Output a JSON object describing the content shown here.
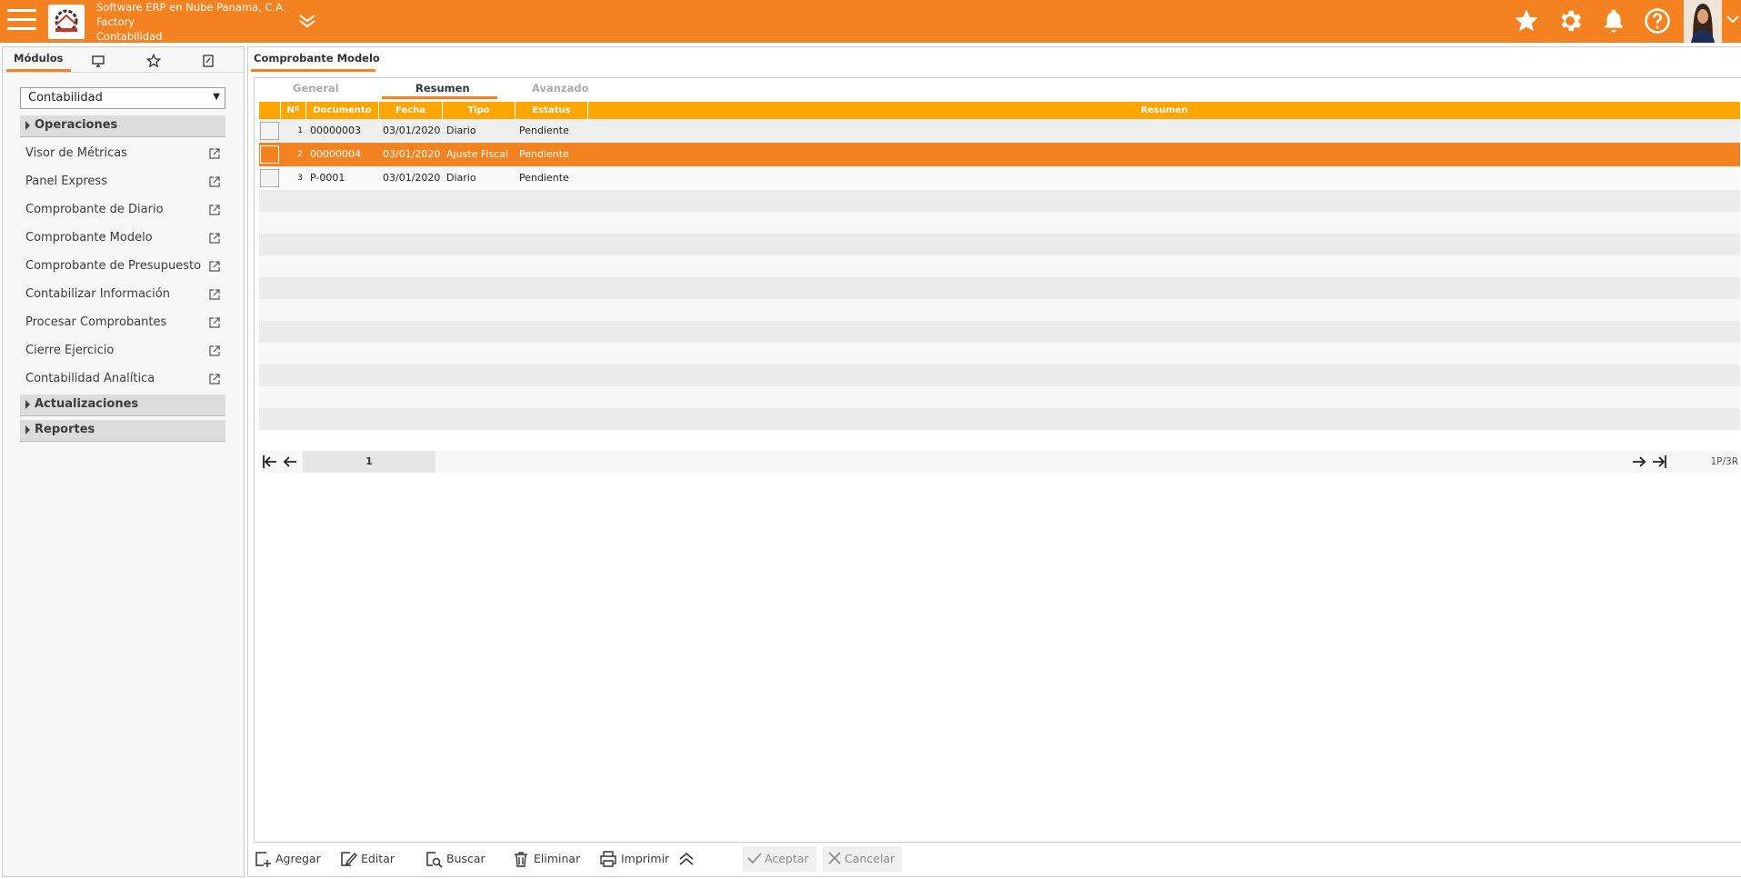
{
  "header": {
    "company_line1": "Software ERP en Nube Panama, C.A.",
    "company_line2": "Factory",
    "company_line3": "Contabilidad",
    "icons": [
      "menu-icon",
      "company-logo",
      "chevron-double-down-icon",
      "star-icon",
      "gear-icon",
      "bell-icon",
      "help-icon",
      "user-avatar"
    ],
    "accent_color": "#f58220"
  },
  "sidebar": {
    "tabs": [
      {
        "label": "Módulos",
        "active": true
      },
      {
        "icon": "monitor-icon"
      },
      {
        "icon": "star-outline-icon"
      },
      {
        "icon": "edit-note-icon"
      }
    ],
    "module_selected": "Contabilidad",
    "sections": [
      {
        "label": "Operaciones",
        "expanded": true
      },
      {
        "label": "Actualizaciones",
        "expanded": false
      },
      {
        "label": "Reportes",
        "expanded": false
      }
    ],
    "items": [
      "Visor de Métricas",
      "Panel Express",
      "Comprobante de Diario",
      "Comprobante Modelo",
      "Comprobante de Presupuesto",
      "Contabilizar Información",
      "Procesar Comprobantes",
      "Cierre Ejercicio",
      "Contabilidad Analítica"
    ]
  },
  "main": {
    "form_title": "Comprobante Modelo",
    "subtabs": [
      {
        "label": "General",
        "active": false
      },
      {
        "label": "Resumen",
        "active": true
      },
      {
        "label": "Avanzado",
        "active": false
      }
    ],
    "grid": {
      "columns": [
        "Nº",
        "Documento",
        "Fecha",
        "Tipo",
        "Estatus",
        "Resumen"
      ],
      "rows": [
        {
          "n": "1",
          "documento": "00000003",
          "fecha": "03/01/2020",
          "tipo": "Diario",
          "estatus": "Pendiente",
          "resumen": "",
          "selected": false
        },
        {
          "n": "2",
          "documento": "00000004",
          "fecha": "03/01/2020",
          "tipo": "Ajuste Fiscal",
          "estatus": "Pendiente",
          "resumen": "",
          "selected": true
        },
        {
          "n": "3",
          "documento": "P-0001",
          "fecha": "03/01/2020",
          "tipo": "Diario",
          "estatus": "Pendiente",
          "resumen": "",
          "selected": false
        }
      ]
    },
    "pager": {
      "current_page": "1",
      "info": "1P/3R"
    }
  },
  "toolbar": {
    "add": "Agregar",
    "edit": "Editar",
    "search": "Buscar",
    "delete": "Eliminar",
    "print": "Imprimir",
    "accept": "Aceptar",
    "cancel": "Cancelar"
  }
}
